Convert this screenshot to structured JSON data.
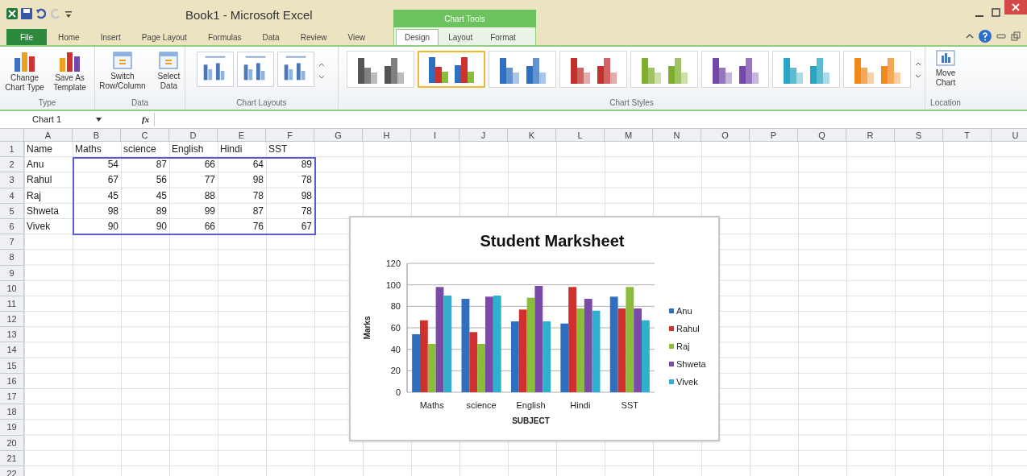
{
  "window": {
    "title": "Book1  -  Microsoft Excel",
    "contextual_title": "Chart Tools"
  },
  "tabs": [
    {
      "label": "File",
      "kind": "file",
      "selected": false
    },
    {
      "label": "Home",
      "kind": "normal",
      "selected": false
    },
    {
      "label": "Insert",
      "kind": "normal",
      "selected": false
    },
    {
      "label": "Page Layout",
      "kind": "normal",
      "selected": false
    },
    {
      "label": "Formulas",
      "kind": "normal",
      "selected": false
    },
    {
      "label": "Data",
      "kind": "normal",
      "selected": false
    },
    {
      "label": "Review",
      "kind": "normal",
      "selected": false
    },
    {
      "label": "View",
      "kind": "normal",
      "selected": false
    }
  ],
  "contextual_tabs": [
    {
      "label": "Design",
      "selected": true
    },
    {
      "label": "Layout",
      "selected": false
    },
    {
      "label": "Format",
      "selected": false
    }
  ],
  "ribbon": {
    "type_group": {
      "label": "Type",
      "buttons": [
        "Change Chart Type",
        "Save As Template"
      ]
    },
    "data_group": {
      "label": "Data",
      "buttons": [
        "Switch Row/Column",
        "Select Data"
      ]
    },
    "layouts_group": {
      "label": "Chart Layouts"
    },
    "styles_group": {
      "label": "Chart Styles",
      "styles": [
        {
          "kind": "mono",
          "color": "#555555",
          "selected": false
        },
        {
          "kind": "multi",
          "color": "#2e6fc0",
          "selected": true
        },
        {
          "kind": "mono",
          "color": "#2e6fc0",
          "selected": false
        },
        {
          "kind": "mono",
          "color": "#c0302e",
          "selected": false
        },
        {
          "kind": "mono",
          "color": "#7fae2e",
          "selected": false
        },
        {
          "kind": "mono",
          "color": "#7448a8",
          "selected": false
        },
        {
          "kind": "mono",
          "color": "#2aa5c0",
          "selected": false
        },
        {
          "kind": "mono",
          "color": "#f08a1e",
          "selected": false
        }
      ]
    },
    "location_group": {
      "label": "Location",
      "button": "Move Chart"
    }
  },
  "formula_bar": {
    "name_box": "Chart 1",
    "fx": "fx"
  },
  "sheet": {
    "columns": [
      "A",
      "B",
      "C",
      "D",
      "E",
      "F",
      "G",
      "H",
      "I",
      "J",
      "K",
      "L",
      "M",
      "N",
      "O",
      "P",
      "Q",
      "R",
      "S",
      "T",
      "U"
    ],
    "rows": [
      {
        "header": "1",
        "cells": [
          "Name",
          "Maths",
          "science",
          "English",
          "Hindi",
          "SST"
        ]
      },
      {
        "header": "2",
        "cells": [
          "Anu",
          "54",
          "87",
          "66",
          "64",
          "89"
        ]
      },
      {
        "header": "3",
        "cells": [
          "Rahul",
          "67",
          "56",
          "77",
          "98",
          "78"
        ]
      },
      {
        "header": "4",
        "cells": [
          "Raj",
          "45",
          "45",
          "88",
          "78",
          "98"
        ]
      },
      {
        "header": "5",
        "cells": [
          "Shweta",
          "98",
          "89",
          "99",
          "87",
          "78"
        ]
      },
      {
        "header": "6",
        "cells": [
          "Vivek",
          "90",
          "90",
          "66",
          "76",
          "67"
        ]
      },
      {
        "header": "7",
        "cells": []
      },
      {
        "header": "8",
        "cells": []
      },
      {
        "header": "9",
        "cells": []
      },
      {
        "header": "10",
        "cells": []
      },
      {
        "header": "11",
        "cells": []
      },
      {
        "header": "12",
        "cells": []
      },
      {
        "header": "13",
        "cells": []
      },
      {
        "header": "14",
        "cells": []
      },
      {
        "header": "15",
        "cells": []
      },
      {
        "header": "16",
        "cells": []
      },
      {
        "header": "17",
        "cells": []
      },
      {
        "header": "18",
        "cells": []
      },
      {
        "header": "19",
        "cells": []
      },
      {
        "header": "20",
        "cells": []
      },
      {
        "header": "21",
        "cells": []
      },
      {
        "header": "22",
        "cells": []
      }
    ]
  },
  "chart": {
    "chart_data": {
      "type": "bar",
      "title": "Student Marksheet",
      "xlabel": "SUBJECT",
      "ylabel": "Marks",
      "categories": [
        "Maths",
        "science",
        "English",
        "Hindi",
        "SST"
      ],
      "series": [
        {
          "name": "Anu",
          "color": "#2e6fc0",
          "values": [
            54,
            87,
            66,
            64,
            89
          ]
        },
        {
          "name": "Rahul",
          "color": "#d0302e",
          "values": [
            67,
            56,
            77,
            98,
            78
          ]
        },
        {
          "name": "Raj",
          "color": "#8cbd3a",
          "values": [
            45,
            45,
            88,
            78,
            98
          ]
        },
        {
          "name": "Shweta",
          "color": "#7a4aa8",
          "values": [
            98,
            89,
            99,
            87,
            78
          ]
        },
        {
          "name": "Vivek",
          "color": "#2fb0cc",
          "values": [
            90,
            90,
            66,
            76,
            67
          ]
        }
      ],
      "grid": true,
      "legend": true,
      "ylim": [
        0,
        120
      ],
      "yticks": [
        0,
        20,
        40,
        60,
        80,
        100,
        120
      ]
    }
  }
}
